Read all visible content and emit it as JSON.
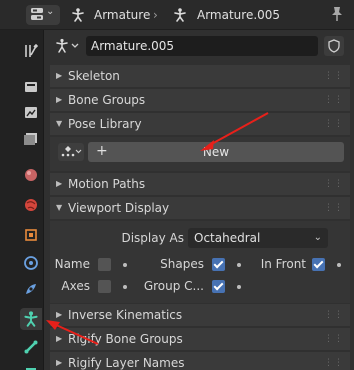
{
  "header": {
    "context_label": "Armature",
    "data_label": "Armature.005"
  },
  "object": {
    "name": "Armature.005"
  },
  "sections": {
    "skeleton": "Skeleton",
    "bone_groups": "Bone Groups",
    "pose_library": "Pose Library",
    "motion_paths": "Motion Paths",
    "viewport_display": "Viewport Display",
    "inverse_kinematics": "Inverse Kinematics",
    "rigify_bone_groups": "Rigify Bone Groups",
    "rigify_layer_names": "Rigify Layer Names"
  },
  "pose_library": {
    "new_label": "New",
    "plus": "+"
  },
  "viewport_display": {
    "display_as_label": "Display As",
    "display_as_value": "Octahedral",
    "name_label": "Name",
    "name_checked": false,
    "shapes_label": "Shapes",
    "shapes_checked": true,
    "in_front_label": "In Front",
    "in_front_checked": true,
    "axes_label": "Axes",
    "axes_checked": false,
    "group_colors_label": "Group C...",
    "group_colors_checked": true
  },
  "colors": {
    "accent": "#4772b3",
    "annotation_arrow": "#e8201a",
    "armature_icon": "#4fd1b0"
  },
  "icons": [
    "editor-type-icon",
    "armature-icon",
    "pin-icon",
    "shield-icon",
    "tool-icon",
    "render-icon",
    "output-icon",
    "view-layer-icon",
    "scene-icon",
    "world-icon",
    "object-icon",
    "modifier-icon",
    "physics-icon",
    "object-data-armature-icon",
    "bone-icon",
    "pose-library-icon"
  ]
}
